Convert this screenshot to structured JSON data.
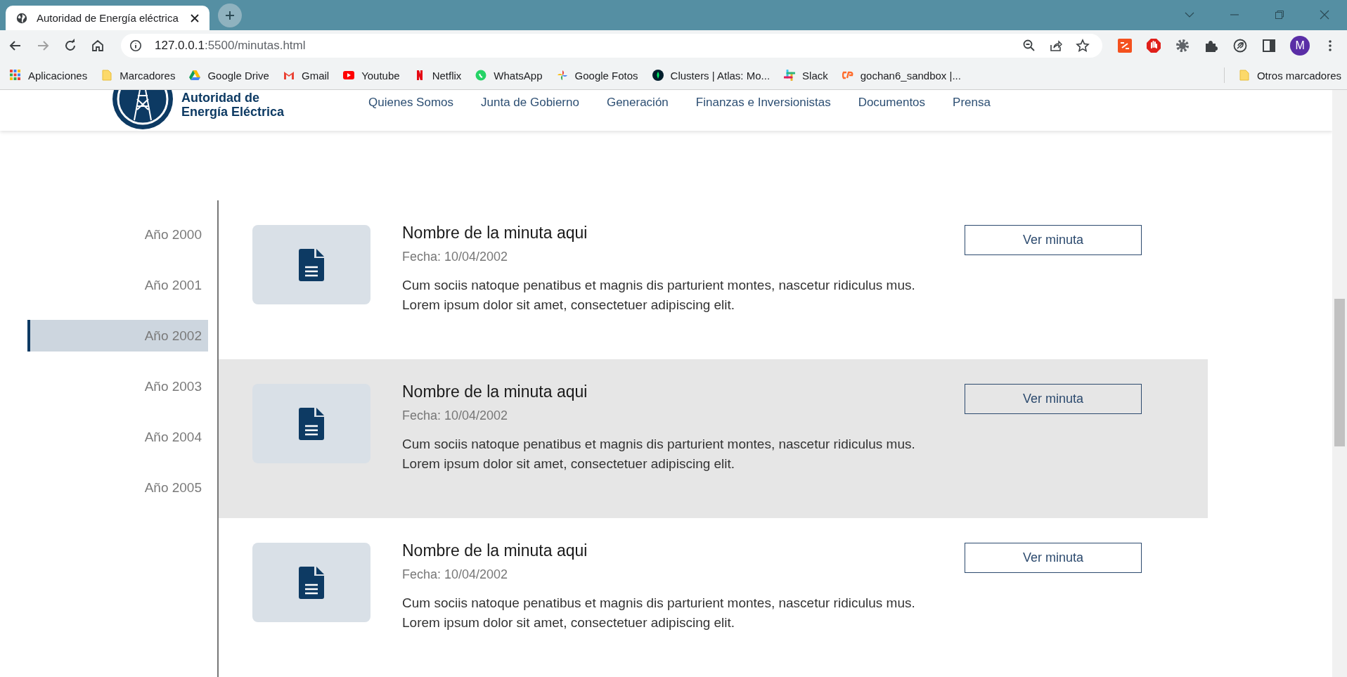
{
  "browser": {
    "tab_title": "Autoridad de Energía eléctrica",
    "url_host": "127.0.0.1",
    "url_rest": ":5500/minutas.html",
    "avatar": "M",
    "bookmarks": [
      {
        "label": "Aplicaciones",
        "kind": "apps"
      },
      {
        "label": "Marcadores",
        "kind": "folder"
      },
      {
        "label": "Google Drive",
        "kind": "drive"
      },
      {
        "label": "Gmail",
        "kind": "gmail"
      },
      {
        "label": "Youtube",
        "kind": "youtube"
      },
      {
        "label": "Netflix",
        "kind": "netflix"
      },
      {
        "label": "WhatsApp",
        "kind": "whatsapp"
      },
      {
        "label": "Google Fotos",
        "kind": "photos"
      },
      {
        "label": "Clusters | Atlas: Mo...",
        "kind": "leaf"
      },
      {
        "label": "Slack",
        "kind": "slack"
      },
      {
        "label": "gochan6_sandbox |...",
        "kind": "cpanel"
      }
    ],
    "other_bookmarks": "Otros marcadores"
  },
  "site": {
    "logo_lines": [
      "Autoridad de",
      "Energía Eléctrica"
    ],
    "nav": [
      "Quienes Somos",
      "Junta de Gobierno",
      "Generación",
      "Finanzas e Inversionistas",
      "Documentos",
      "Prensa"
    ]
  },
  "years": [
    {
      "label": "Año 2000",
      "selected": false
    },
    {
      "label": "Año 2001",
      "selected": false
    },
    {
      "label": "Año 2002",
      "selected": true
    },
    {
      "label": "Año 2003",
      "selected": false
    },
    {
      "label": "Año 2004",
      "selected": false
    },
    {
      "label": "Año 2005",
      "selected": false
    }
  ],
  "minutes": [
    {
      "title": "Nombre de la minuta aqui",
      "date": "Fecha: 10/04/2002",
      "text": "Cum sociis natoque penatibus et magnis dis parturient montes, nascetur ridiculus mus. Lorem ipsum dolor sit amet, consectetuer adipiscing elit.",
      "button": "Ver minuta",
      "highlighted": false
    },
    {
      "title": "Nombre de la minuta aqui",
      "date": "Fecha: 10/04/2002",
      "text": "Cum sociis natoque penatibus et magnis dis parturient montes, nascetur ridiculus mus. Lorem ipsum dolor sit amet, consectetuer adipiscing elit.",
      "button": "Ver minuta",
      "highlighted": true
    },
    {
      "title": "Nombre de la minuta aqui",
      "date": "Fecha: 10/04/2002",
      "text": "Cum sociis natoque penatibus et magnis dis parturient montes, nascetur ridiculus mus. Lorem ipsum dolor sit amet, consectetuer adipiscing elit.",
      "button": "Ver minuta",
      "highlighted": false
    }
  ]
}
